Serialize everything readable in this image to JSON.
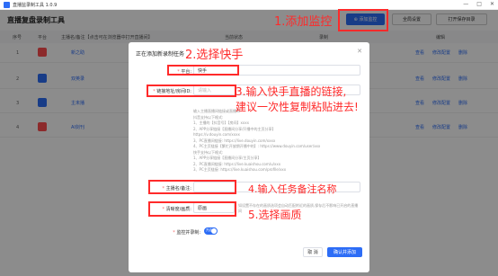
{
  "window": {
    "title": "直播监录制工具 1.0.9",
    "min": "—",
    "max": "□",
    "close": "✕"
  },
  "header": {
    "app_title": "直播复盘录制工具",
    "add_btn": "⊕ 添加监控",
    "settings_btn": "全局设置",
    "open_dir_btn": "打开保存目录"
  },
  "table": {
    "columns": [
      "序号",
      "平台",
      "主播名/备注【点击可在浏览器中打开直播间】",
      "当前状态",
      "录制",
      "编辑"
    ],
    "rows": [
      {
        "idx": "1",
        "platform_color": "#ff4d4f",
        "name": "新之助",
        "edit": "修改配置",
        "delete": "删除",
        "view": "查看"
      },
      {
        "idx": "2",
        "platform_color": "#2d6df6",
        "name": "双英录",
        "edit": "修改配置",
        "delete": "删除",
        "view": "查看"
      },
      {
        "idx": "3",
        "platform_color": "#2d6df6",
        "name": "主未播",
        "edit": "修改配置",
        "delete": "删除",
        "view": "查看"
      },
      {
        "idx": "4",
        "platform_color": "#ff4d4f",
        "name": "AI剑刊",
        "edit": "修改配置",
        "delete": "删除",
        "view": "查看"
      }
    ]
  },
  "dialog": {
    "title": "正在添加新录制任务",
    "close": "✕",
    "platform_label": "平台:",
    "platform_value": "快手",
    "url_label": "链接地址/房间ID:",
    "url_placeholder": "请输入",
    "help_lines": [
      "输入主播直播间链接或直播ID",
      "抖音支持以下格式:",
      "1、主播的【抖音号】【房间】xxxx",
      "2、APP分享链接【直播间分享/开播中的主页分享】",
      "https://v.douyin.com/xxxx",
      "3、PC直播间链接: https://live.douyin.com/xxxx",
      "4、PC主页链接【繁忙开放期开播中的】: https://www.douyin.com/user/xxx",
      "快手支持以下格式:",
      "1、APP分享链接【直播间分享/主页分享】",
      "2、PC直播间链接: https://live.kuaishou.com/u/xxx",
      "3、PC主页链接: https://live.kuaishou.com/profile/xxx"
    ],
    "name_label": "主播名/备注:",
    "quality_label": "清晰度/画质:",
    "quality_value": "原画",
    "quality_help": "如设置不存在的画质选项会自动匹配附近的画质,保存后不影响已开启的直播间",
    "loop_label": "监控并录制:",
    "loop_toggle": "开启",
    "cancel": "取 消",
    "confirm": "确认并添加"
  },
  "annotations": {
    "note1": "1.添加监控",
    "note2": "2.选择快手",
    "note3a": "3.输入快手直播的链接,",
    "note3b": "建议一次性复制粘贴进去!",
    "note4": "4.输入任务备注名称",
    "note5": "5.选择画质",
    "red": "#ff2a2a"
  },
  "colors": {
    "accent": "#2d6df6",
    "danger": "#ff4d4f"
  }
}
